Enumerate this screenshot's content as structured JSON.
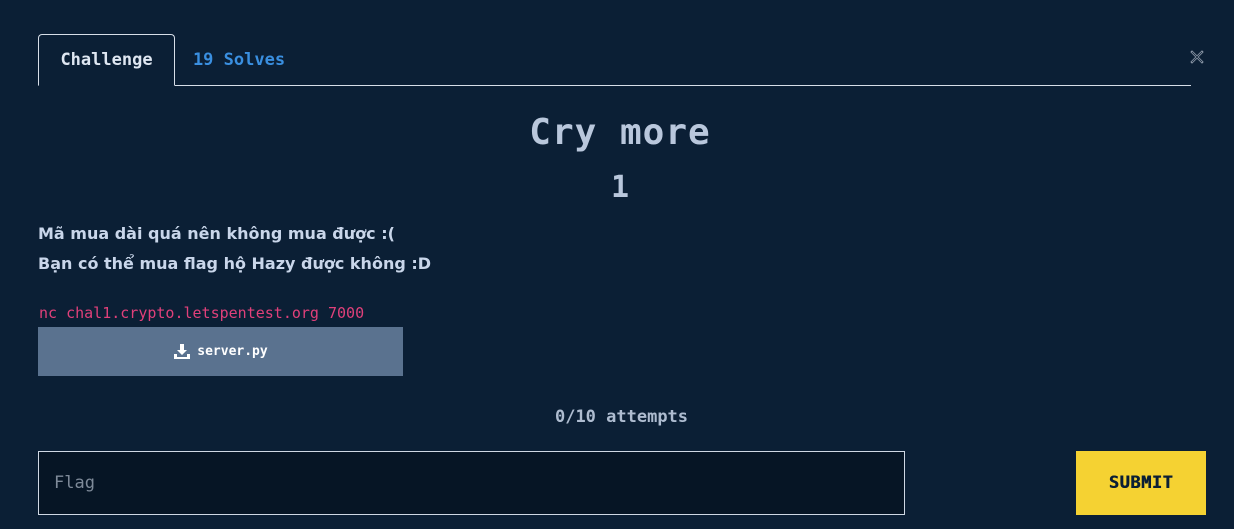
{
  "tabs": {
    "challenge_label": "Challenge",
    "solves_label": "19 Solves"
  },
  "challenge": {
    "title": "Cry more",
    "points": "1",
    "description_line1": "Mã mua dài quá nên không mua được :(",
    "description_line2": "Bạn có thể mua flag hộ Hazy được không :D",
    "connection": "nc chal1.crypto.letspentest.org 7000",
    "file_name": "server.py",
    "attempts": "0/10 attempts"
  },
  "form": {
    "flag_placeholder": "Flag",
    "submit_label": "SUBMIT"
  },
  "icons": {
    "close": "close-icon",
    "download": "download-icon"
  },
  "colors": {
    "background": "#0b1f35",
    "solves_link": "#3a8fe0",
    "connection_text": "#e0407a",
    "download_button": "#5a728f",
    "submit_button": "#f5d232"
  }
}
